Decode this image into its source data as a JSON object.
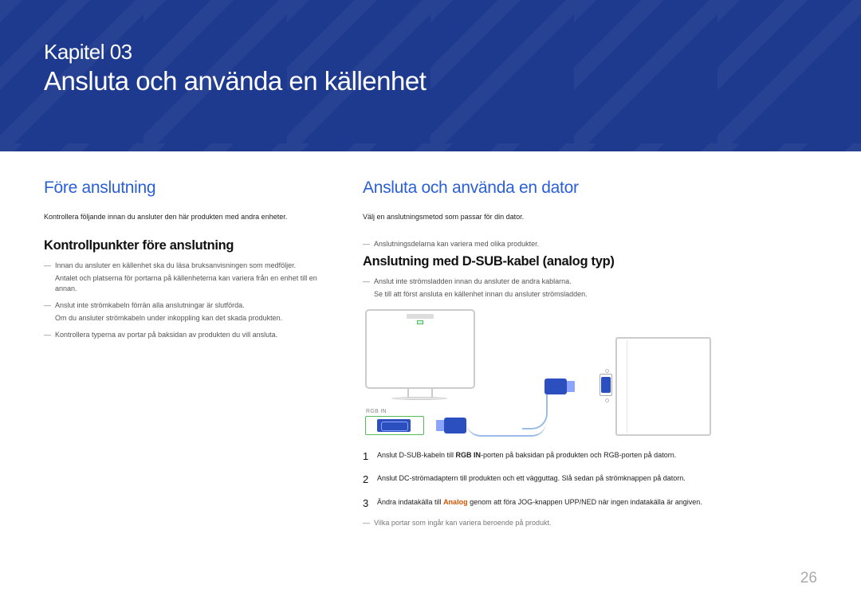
{
  "header": {
    "chapter_label": "Kapitel 03",
    "chapter_title": "Ansluta och använda en källenhet"
  },
  "left": {
    "section_title": "Före anslutning",
    "intro": "Kontrollera följande innan du ansluter den här produkten med andra enheter.",
    "subsection_title": "Kontrollpunkter före anslutning",
    "notes": [
      {
        "main": "Innan du ansluter en källenhet ska du läsa bruksanvisningen som medföljer.",
        "sub": "Antalet och platserna för portarna på källenheterna kan variera från en enhet till en annan."
      },
      {
        "main": "Anslut inte strömkabeln förrän alla anslutningar är slutförda.",
        "sub": "Om du ansluter strömkabeln under inkoppling kan det skada produkten."
      },
      {
        "main": "Kontrollera typerna av portar på baksidan av produkten du vill ansluta.",
        "sub": ""
      }
    ]
  },
  "right": {
    "section_title": "Ansluta och använda en dator",
    "intro": "Välj en anslutningsmetod som passar för din dator.",
    "intro_note": "Anslutningsdelarna kan variera med olika produkter.",
    "subsection_title": "Anslutning med D-SUB-kabel (analog typ)",
    "sub_notes": [
      "Anslut inte strömsladden innan du ansluter de andra kablarna.",
      "Se till att först ansluta en källenhet innan du ansluter strömsladden."
    ],
    "rgb_label": "RGB IN",
    "steps": [
      {
        "num": "1",
        "pre": "Anslut D-SUB-kabeln till ",
        "bold": "RGB IN",
        "post": "-porten på baksidan på produkten och RGB-porten på datorn."
      },
      {
        "num": "2",
        "pre": "Anslut DC-strömadaptern till produkten och ett vägguttag. Slå sedan på strömknappen på datorn.",
        "bold": "",
        "post": ""
      },
      {
        "num": "3",
        "pre": "Ändra indatakälla till ",
        "analog": "Analog",
        "post": " genom att föra JOG-knappen UPP/NED när ingen indatakälla är angiven."
      }
    ],
    "footer_note": "Vilka portar som ingår kan variera beroende på produkt."
  },
  "page_number": "26"
}
